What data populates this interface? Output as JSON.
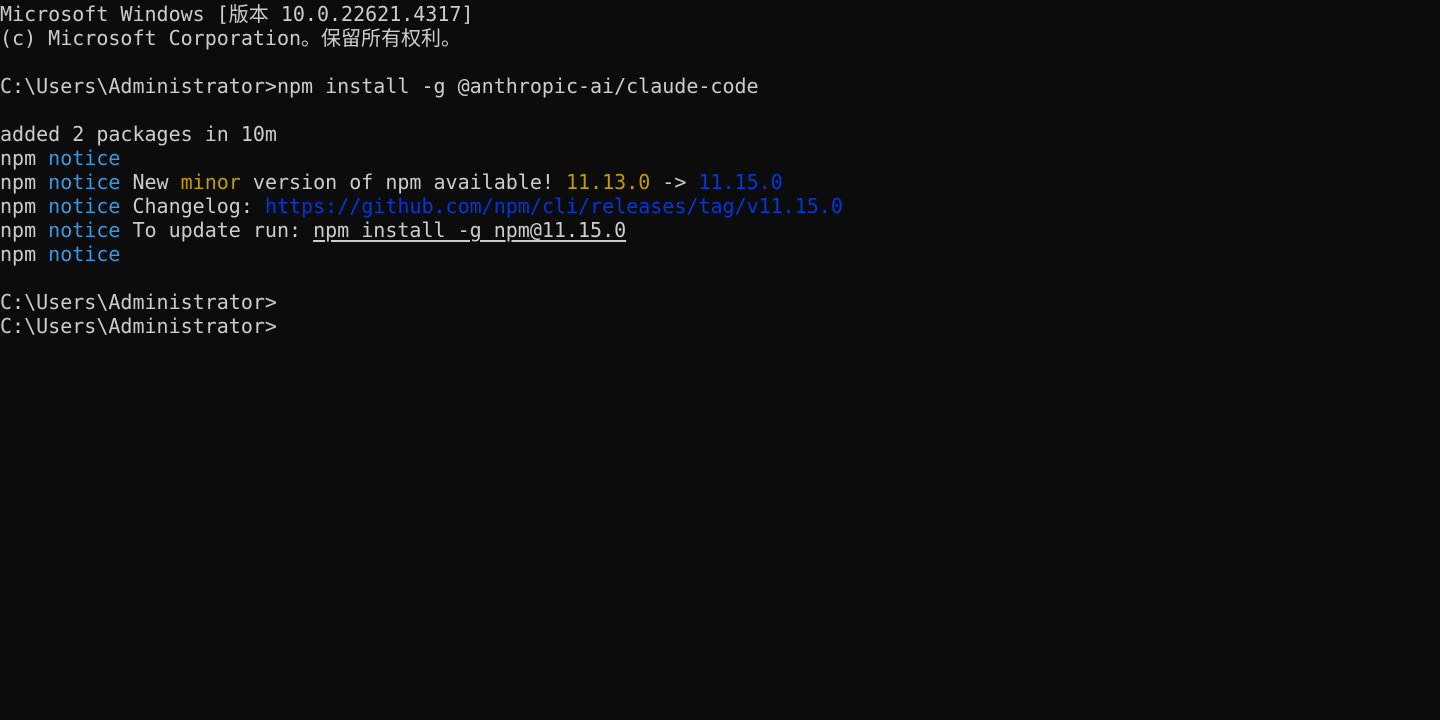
{
  "colors": {
    "background": "#0c0c0c",
    "default": "#cccccc",
    "notice": "#3a96dd",
    "minor": "#c19c00",
    "blue": "#0037da"
  },
  "terminal": {
    "lines": [
      {
        "name": "windows-version-line",
        "segments": [
          {
            "text": "Microsoft Windows [版本 10.0.22621.4317]",
            "color": "default"
          }
        ]
      },
      {
        "name": "copyright-line",
        "segments": [
          {
            "text": "(c) Microsoft Corporation。保留所有权利。",
            "color": "default"
          }
        ]
      },
      {
        "name": "blank-line",
        "segments": []
      },
      {
        "name": "command-line-npm-install",
        "segments": [
          {
            "text": "C:\\Users\\Administrator>",
            "color": "default"
          },
          {
            "text": "npm install -g @anthropic-ai/claude-code",
            "color": "default"
          }
        ]
      },
      {
        "name": "blank-line",
        "segments": []
      },
      {
        "name": "output-added-packages",
        "segments": [
          {
            "text": "added 2 packages in 10m",
            "color": "default"
          }
        ]
      },
      {
        "name": "npm-notice-line",
        "segments": [
          {
            "text": "npm ",
            "color": "default"
          },
          {
            "text": "notice",
            "color": "notice"
          }
        ]
      },
      {
        "name": "npm-notice-new-version-line",
        "segments": [
          {
            "text": "npm ",
            "color": "default"
          },
          {
            "text": "notice",
            "color": "notice"
          },
          {
            "text": " New ",
            "color": "default"
          },
          {
            "text": "minor",
            "color": "minor"
          },
          {
            "text": " version of npm available! ",
            "color": "default"
          },
          {
            "text": "11.13.0",
            "color": "minor"
          },
          {
            "text": " -> ",
            "color": "default"
          },
          {
            "text": "11.15.0",
            "color": "blue"
          }
        ]
      },
      {
        "name": "npm-notice-changelog-line",
        "segments": [
          {
            "text": "npm ",
            "color": "default"
          },
          {
            "text": "notice",
            "color": "notice"
          },
          {
            "text": " Changelog: ",
            "color": "default"
          },
          {
            "text": "https://github.com/npm/cli/releases/tag/v11.15.0",
            "color": "blue",
            "link": true
          }
        ]
      },
      {
        "name": "npm-notice-update-line",
        "segments": [
          {
            "text": "npm ",
            "color": "default"
          },
          {
            "text": "notice",
            "color": "notice"
          },
          {
            "text": " To update run: ",
            "color": "default"
          },
          {
            "text": "npm install -g npm@11.15.0",
            "color": "default",
            "underline": true
          }
        ]
      },
      {
        "name": "npm-notice-line",
        "segments": [
          {
            "text": "npm ",
            "color": "default"
          },
          {
            "text": "notice",
            "color": "notice"
          }
        ]
      },
      {
        "name": "blank-line",
        "segments": []
      },
      {
        "name": "prompt-line",
        "segments": [
          {
            "text": "C:\\Users\\Administrator>",
            "color": "default"
          }
        ]
      },
      {
        "name": "prompt-line-current",
        "segments": [
          {
            "text": "C:\\Users\\Administrator>",
            "color": "default"
          }
        ]
      }
    ]
  }
}
